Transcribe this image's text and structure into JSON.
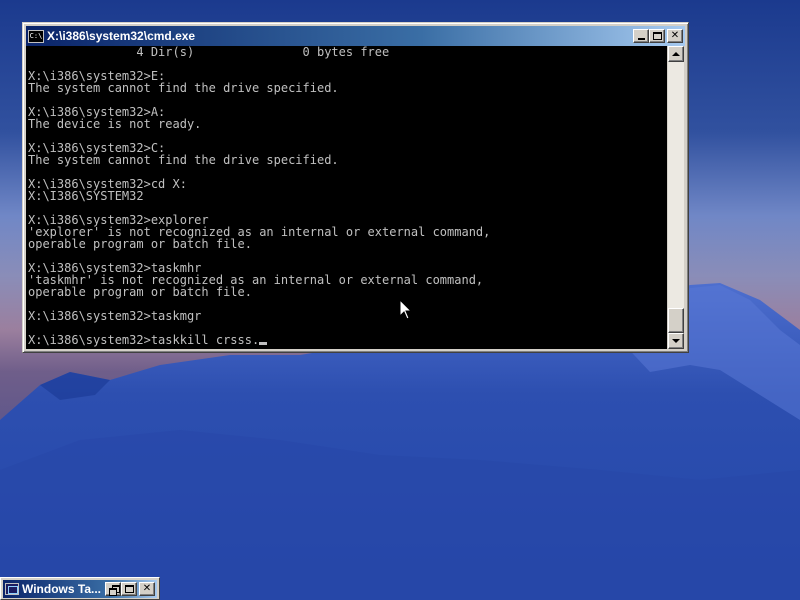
{
  "desktop": {
    "colors": {
      "sky_top": "#1e3a8c",
      "sky_mid": "#6a80c2",
      "horizon": "#9b88a6",
      "mountain": "#2a4aa6",
      "mountain_shadow": "#1f3a90",
      "snow": "#6f8ee0"
    }
  },
  "cmd_window": {
    "title": "X:\\i386\\system32\\cmd.exe",
    "icon_label": "C:\\",
    "buttons": {
      "minimize": "minimize-icon",
      "maximize": "maximize-icon",
      "close": "✕"
    },
    "console": {
      "colors": {
        "background": "#000000",
        "text": "#c0c0c0"
      },
      "lines": [
        "               4 Dir(s)               0 bytes free",
        "",
        "X:\\i386\\system32>E:",
        "The system cannot find the drive specified.",
        "",
        "X:\\i386\\system32>A:",
        "The device is not ready.",
        "",
        "X:\\i386\\system32>C:",
        "The system cannot find the drive specified.",
        "",
        "X:\\i386\\system32>cd X:",
        "X:\\I386\\SYSTEM32",
        "",
        "X:\\i386\\system32>explorer",
        "'explorer' is not recognized as an internal or external command,",
        "operable program or batch file.",
        "",
        "X:\\i386\\system32>taskmhr",
        "'taskmhr' is not recognized as an internal or external command,",
        "operable program or batch file.",
        "",
        "X:\\i386\\system32>taskmgr",
        "",
        "X:\\i386\\system32>taskkill crsss."
      ]
    }
  },
  "minimized_task": {
    "title": "Windows Ta...",
    "buttons": {
      "restore": "restore-icon",
      "maximize": "maximize-icon",
      "close": "✕"
    }
  }
}
